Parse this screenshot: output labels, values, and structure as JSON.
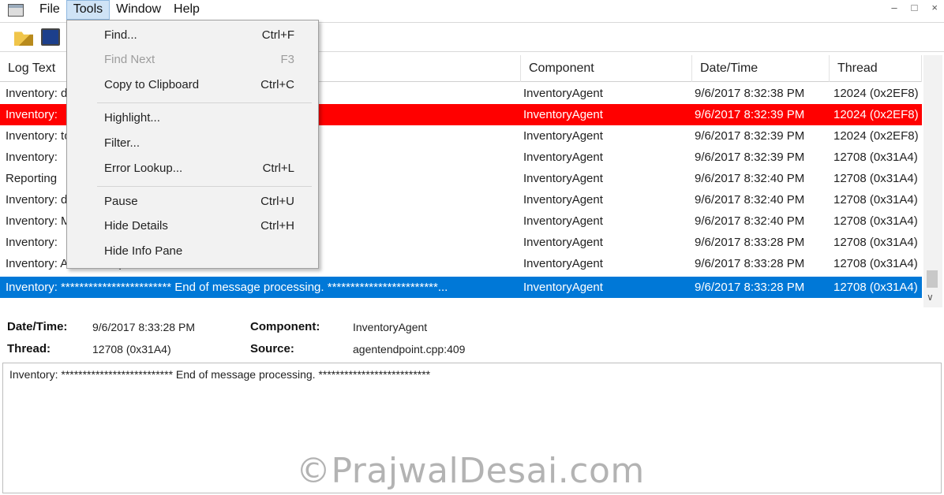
{
  "menubar": {
    "items": [
      "File",
      "Tools",
      "Window",
      "Help"
    ],
    "active": "Tools",
    "window_controls": [
      "–",
      "□",
      "×"
    ]
  },
  "toolbar": {
    "icons": [
      "open-folder-icon",
      "computer-icon"
    ]
  },
  "tools_menu": {
    "items": [
      {
        "label": "Find...",
        "shortcut": "Ctrl+F"
      },
      {
        "label": "Find Next",
        "shortcut": "F3"
      },
      {
        "label": "Copy to Clipboard",
        "shortcut": "Ctrl+C"
      },
      {
        "label": "Highlight...",
        "shortcut": ""
      },
      {
        "label": "Filter...",
        "shortcut": ""
      },
      {
        "label": "Error Lookup...",
        "shortcut": "Ctrl+L"
      },
      {
        "label": "Pause",
        "shortcut": "Ctrl+U"
      },
      {
        "label": "Hide Details",
        "shortcut": "Ctrl+H"
      },
      {
        "label": "Hide Info Pane",
        "shortcut": ""
      }
    ]
  },
  "grid": {
    "columns": [
      "Log Text",
      "Component",
      "Date/Time",
      "Thread"
    ],
    "rows": [
      {
        "log": "Inventory:                                                                       ds",
        "component": "InventoryAgent",
        "datetime": "9/6/2017 8:32:38 PM",
        "thread": "12024 (0x2EF8)"
      },
      {
        "log": "Inventory:",
        "component": "InventoryAgent",
        "datetime": "9/6/2017 8:32:39 PM",
        "thread": "12024 (0x2EF8)"
      },
      {
        "log": "Inventory:                                                              tory\\Temp\\db4ec324-8ebf-404...",
        "component": "InventoryAgent",
        "datetime": "9/6/2017 8:32:39 PM",
        "thread": "12024 (0x2EF8)"
      },
      {
        "log": "Inventory:",
        "component": "InventoryAgent",
        "datetime": "9/6/2017 8:32:39 PM",
        "thread": "12708 (0x31A4)"
      },
      {
        "log": "Reporting",
        "component": "InventoryAgent",
        "datetime": "9/6/2017 8:32:40 PM",
        "thread": "12708 (0x31A4)"
      },
      {
        "log": "Inventory:                                                                       ds",
        "component": "InventoryAgent",
        "datetime": "9/6/2017 8:32:40 PM",
        "thread": "12708 (0x31A4)"
      },
      {
        "log": "Inventory:                                                              MP_HinvEndpoint, ID: {CCD066...",
        "component": "InventoryAgent",
        "datetime": "9/6/2017 8:32:40 PM",
        "thread": "12708 (0x31A4)"
      },
      {
        "log": "Inventory:",
        "component": "InventoryAgent",
        "datetime": "9/6/2017 8:33:28 PM",
        "thread": "12708 (0x31A4)"
      },
      {
        "log": "Inventory: Action completed.",
        "component": "InventoryAgent",
        "datetime": "9/6/2017 8:33:28 PM",
        "thread": "12708 (0x31A4)"
      },
      {
        "log": "Inventory: ************************ End of message processing. ************************...",
        "component": "InventoryAgent",
        "datetime": "9/6/2017 8:33:28 PM",
        "thread": "12708 (0x31A4)"
      }
    ]
  },
  "details": {
    "datetime_label": "Date/Time:",
    "datetime_value": "9/6/2017 8:33:28 PM",
    "thread_label": "Thread:",
    "thread_value": "12708 (0x31A4)",
    "component_label": "Component:",
    "component_value": "InventoryAgent",
    "source_label": "Source:",
    "source_value": "agentendpoint.cpp:409"
  },
  "message": "Inventory: ************************** End of message processing. **************************",
  "watermark": "©PrajwalDesai.com",
  "colors": {
    "error_row": "#ff0000",
    "selected_row": "#0078d7",
    "menu_bg": "#f2f2f2"
  }
}
